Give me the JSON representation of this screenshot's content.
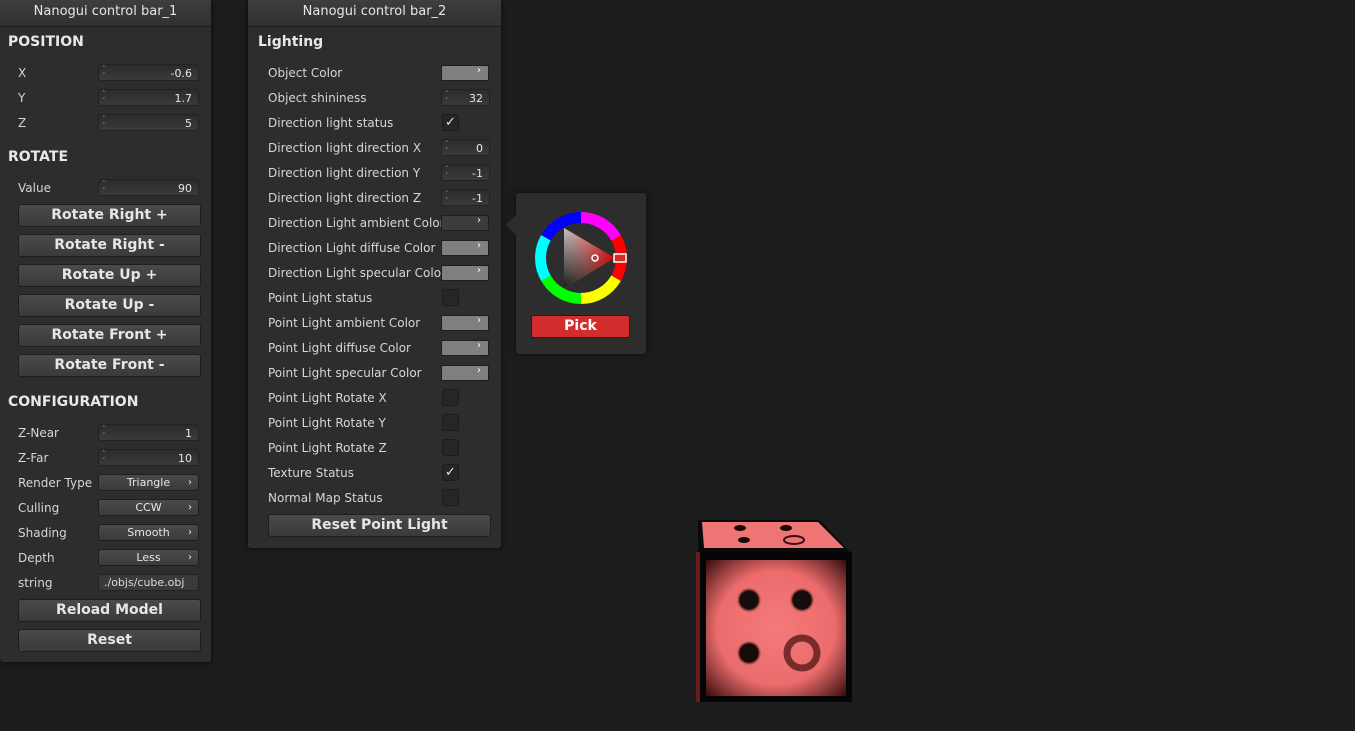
{
  "panel1": {
    "title": "Nanogui control bar_1",
    "position": {
      "title": "POSITION",
      "fields": [
        {
          "label": "X",
          "value": "-0.6"
        },
        {
          "label": "Y",
          "value": "1.7"
        },
        {
          "label": "Z",
          "value": "5"
        }
      ]
    },
    "rotate": {
      "title": "ROTATE",
      "value_label": "Value",
      "value": "90",
      "buttons": [
        "Rotate Right +",
        "Rotate Right -",
        "Rotate Up +",
        "Rotate Up -",
        "Rotate Front +",
        "Rotate Front -"
      ]
    },
    "configuration": {
      "title": "CONFIGURATION",
      "znear_label": "Z-Near",
      "znear": "1",
      "zfar_label": "Z-Far",
      "zfar": "10",
      "render_type_label": "Render Type",
      "render_type": "Triangle",
      "culling_label": "Culling",
      "culling": "CCW",
      "shading_label": "Shading",
      "shading": "Smooth",
      "depth_label": "Depth",
      "depth": "Less",
      "string_label": "string",
      "string_value": "./objs/cube.obj",
      "reload_button": "Reload Model",
      "reset_button": "Reset"
    }
  },
  "panel2": {
    "title": "Nanogui control bar_2",
    "group": "Lighting",
    "rows": [
      {
        "label": "Object Color"
      },
      {
        "label": "Object shininess",
        "value": "32"
      },
      {
        "label": "Direction light status",
        "checked": "✓"
      },
      {
        "label": "Direction light direction X",
        "value": "0"
      },
      {
        "label": "Direction light direction Y",
        "value": "-1"
      },
      {
        "label": "Direction light direction Z",
        "value": "-1"
      },
      {
        "label": "Direction Light ambient Color"
      },
      {
        "label": "Direction Light diffuse Color"
      },
      {
        "label": "Direction Light specular Color"
      },
      {
        "label": "Point Light status",
        "checked": ""
      },
      {
        "label": "Point Light ambient Color"
      },
      {
        "label": "Point Light diffuse Color"
      },
      {
        "label": "Point Light specular Color"
      },
      {
        "label": "Point Light Rotate X",
        "checked": ""
      },
      {
        "label": "Point Light Rotate Y",
        "checked": ""
      },
      {
        "label": "Point Light Rotate Z",
        "checked": ""
      },
      {
        "label": "Texture Status",
        "checked": "✓"
      },
      {
        "label": "Normal Map Status",
        "checked": ""
      }
    ],
    "reset_point_light": "Reset Point Light",
    "chevron": "›"
  },
  "color_picker": {
    "pick_label": "Pick",
    "selected_color": "#d42c2c"
  },
  "icons": {
    "spin": "spinner-arrows-icon",
    "check": "checkmark-icon",
    "chevron": "chevron-right-icon"
  },
  "colors": {
    "panel_bg": "#2d2d2d",
    "background": "#1c1c1c",
    "swatch_gray": "#7f7f7f",
    "cube_face": "#f07474"
  }
}
